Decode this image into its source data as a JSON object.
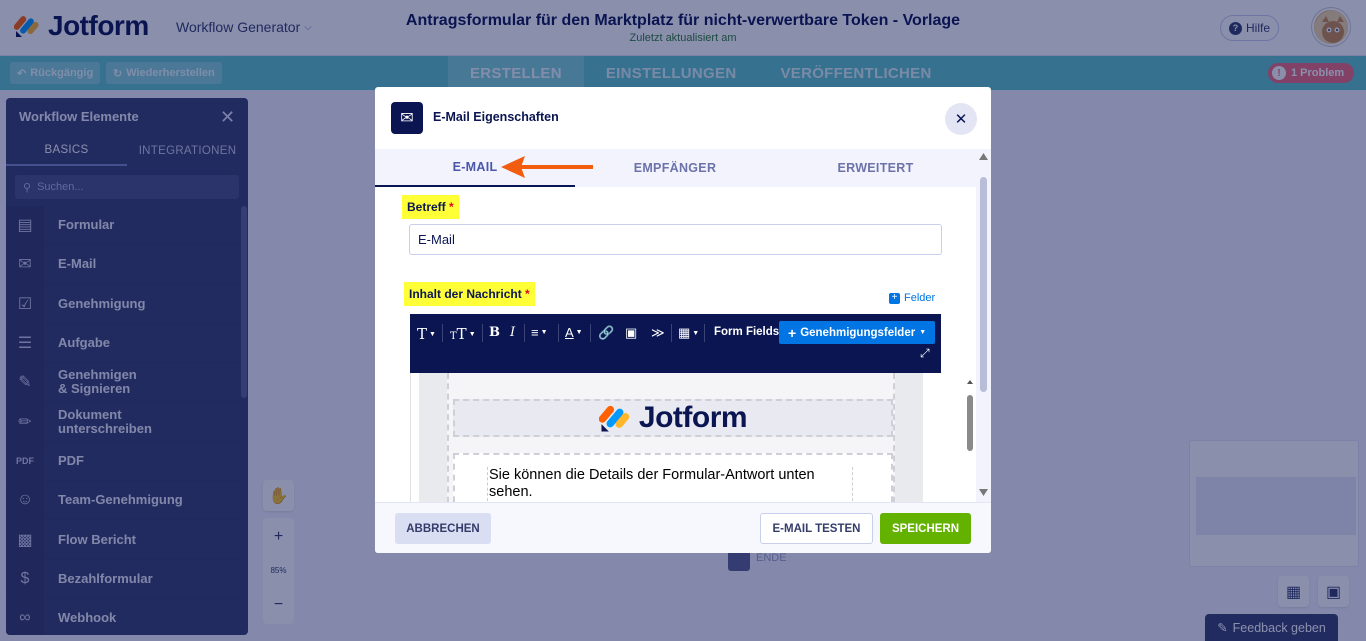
{
  "header": {
    "logo_text": "Jotform",
    "workflow_generator": "Workflow Generator",
    "form_title": "Antragsformular für den Marktplatz für nicht-verwertbare Token - Vorlage",
    "last_updated": "Zuletzt aktualisiert am",
    "help_label": "Hilfe"
  },
  "toolbar": {
    "undo_label": "Rückgängig",
    "redo_label": "Wiederherstellen",
    "tabs": [
      "ERSTELLEN",
      "EINSTELLUNGEN",
      "VERÖFFENTLICHEN"
    ],
    "active_tab": "ERSTELLEN",
    "problem_label": "1 Problem"
  },
  "sidebar": {
    "title": "Workflow Elemente",
    "tabs": [
      "BASICS",
      "INTEGRATIONEN"
    ],
    "search_placeholder": "Suchen...",
    "items": [
      {
        "label": "Formular",
        "icon": "form-icon"
      },
      {
        "label": "E-Mail",
        "icon": "email-icon"
      },
      {
        "label": "Genehmigung",
        "icon": "approval-icon"
      },
      {
        "label": "Aufgabe",
        "icon": "task-icon"
      },
      {
        "label": "Genehmigen & Signieren",
        "icon": "approve-sign-icon"
      },
      {
        "label": "Dokument unterschreiben",
        "icon": "sign-document-icon"
      },
      {
        "label": "PDF",
        "icon": "pdf-icon"
      },
      {
        "label": "Team-Genehmigung",
        "icon": "team-approval-icon"
      },
      {
        "label": "Flow Bericht",
        "icon": "flow-report-icon"
      },
      {
        "label": "Bezahlformular",
        "icon": "payment-form-icon"
      },
      {
        "label": "Webhook",
        "icon": "webhook-icon"
      }
    ]
  },
  "canvas": {
    "zoom_level": "85%",
    "end_label": "ENDE",
    "feedback_label": "Feedback geben"
  },
  "modal": {
    "title": "E-Mail Eigenschaften",
    "tabs": [
      "E-MAIL",
      "EMPFÄNGER",
      "ERWEITERT"
    ],
    "active_tab": "E-MAIL",
    "subject_label": "Betreff",
    "required_mark": "*",
    "fields_link": "Felder",
    "subject_value": "E-Mail",
    "message_label": "Inhalt der Nachricht",
    "editor": {
      "form_fields_label": "Form Fields",
      "approval_fields_label": "Genehmigungsfelder"
    },
    "email_preview": {
      "logo_text": "Jotform",
      "body_text": "Sie können die Details der Formular-Antwort unten sehen."
    },
    "cancel_label": "ABBRECHEN",
    "test_label": "E-MAIL TESTEN",
    "save_label": "SPEICHERN"
  },
  "colors": {
    "brand_navy": "#0a1551",
    "toolbar_teal": "#5fc6c8",
    "save_green": "#64b200",
    "link_blue": "#0075e3",
    "highlight_yellow": "#ffff38",
    "arrow_orange": "#f25c0e"
  }
}
